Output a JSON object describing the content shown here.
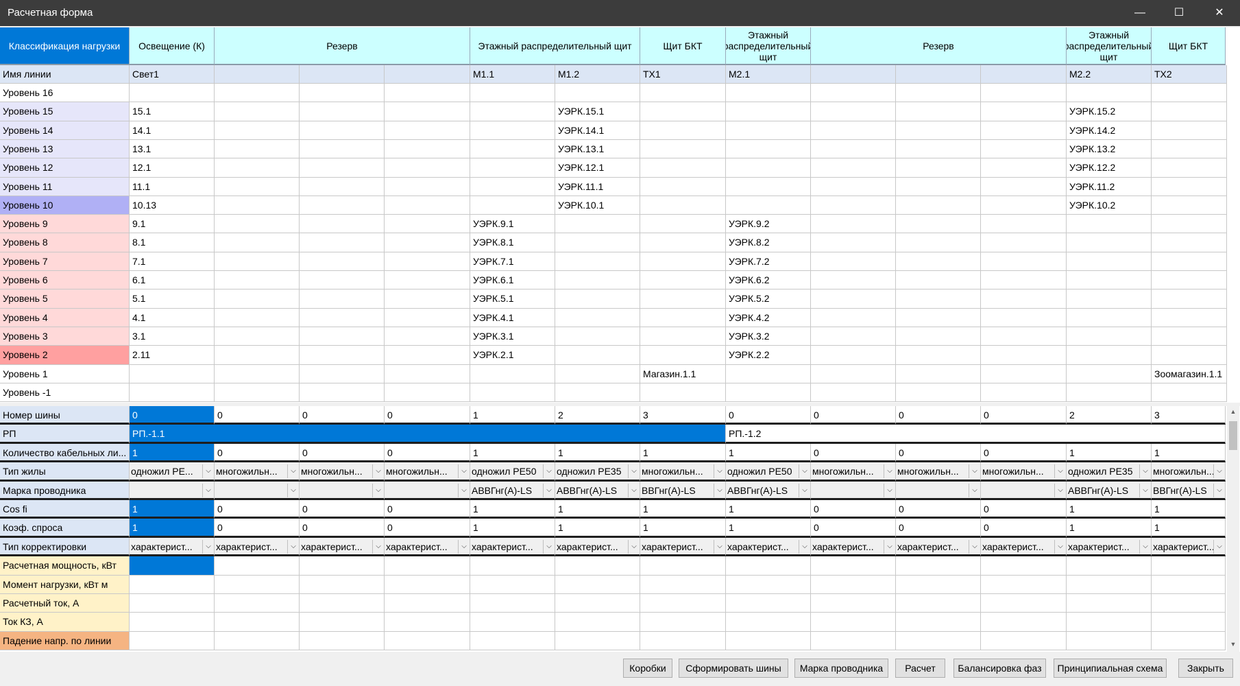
{
  "window": {
    "title": "Расчетная форма",
    "minimize_glyph": "—",
    "maximize_glyph": "☐",
    "close_glyph": "✕"
  },
  "groups": [
    {
      "label": "Классификация нагрузки"
    },
    {
      "label": "Освещение (К)"
    },
    {
      "label": "Резерв"
    },
    {
      "label": "Этажный распределительный щит"
    },
    {
      "label": "Щит БКТ"
    },
    {
      "label": "Этажный распределительный щит"
    },
    {
      "label": "Резерв"
    },
    {
      "label": "Этажный распределительный щит"
    },
    {
      "label": "Щит БКТ"
    }
  ],
  "line_names": {
    "label": "Имя линии",
    "values": [
      "Свет1",
      "",
      "",
      "",
      "М1.1",
      "М1.2",
      "ТХ1",
      "М2.1",
      "",
      "",
      "",
      "М2.2",
      "ТХ2"
    ]
  },
  "levels": [
    {
      "name": "Уровень 16",
      "color": "#ffffff",
      "cells": [
        "",
        "",
        "",
        "",
        "",
        "",
        "",
        "",
        "",
        "",
        "",
        "",
        ""
      ]
    },
    {
      "name": "Уровень 15",
      "color": "#e6e6fa",
      "cells": [
        "15.1",
        "",
        "",
        "",
        "",
        "УЭРК.15.1",
        "",
        "",
        "",
        "",
        "",
        "УЭРК.15.2",
        ""
      ]
    },
    {
      "name": "Уровень 14",
      "color": "#e6e6fa",
      "cells": [
        "14.1",
        "",
        "",
        "",
        "",
        "УЭРК.14.1",
        "",
        "",
        "",
        "",
        "",
        "УЭРК.14.2",
        ""
      ]
    },
    {
      "name": "Уровень 13",
      "color": "#e6e6fa",
      "cells": [
        "13.1",
        "",
        "",
        "",
        "",
        "УЭРК.13.1",
        "",
        "",
        "",
        "",
        "",
        "УЭРК.13.2",
        ""
      ]
    },
    {
      "name": "Уровень 12",
      "color": "#e6e6fa",
      "cells": [
        "12.1",
        "",
        "",
        "",
        "",
        "УЭРК.12.1",
        "",
        "",
        "",
        "",
        "",
        "УЭРК.12.2",
        ""
      ]
    },
    {
      "name": "Уровень 11",
      "color": "#e6e6fa",
      "cells": [
        "11.1",
        "",
        "",
        "",
        "",
        "УЭРК.11.1",
        "",
        "",
        "",
        "",
        "",
        "УЭРК.11.2",
        ""
      ]
    },
    {
      "name": "Уровень 10",
      "color": "#b0b0f5",
      "cells": [
        "10.13",
        "",
        "",
        "",
        "",
        "УЭРК.10.1",
        "",
        "",
        "",
        "",
        "",
        "УЭРК.10.2",
        ""
      ]
    },
    {
      "name": "Уровень 9",
      "color": "#ffd9d9",
      "cells": [
        "9.1",
        "",
        "",
        "",
        "УЭРК.9.1",
        "",
        "",
        "УЭРК.9.2",
        "",
        "",
        "",
        "",
        ""
      ]
    },
    {
      "name": "Уровень 8",
      "color": "#ffd9d9",
      "cells": [
        "8.1",
        "",
        "",
        "",
        "УЭРК.8.1",
        "",
        "",
        "УЭРК.8.2",
        "",
        "",
        "",
        "",
        ""
      ]
    },
    {
      "name": "Уровень 7",
      "color": "#ffd9d9",
      "cells": [
        "7.1",
        "",
        "",
        "",
        "УЭРК.7.1",
        "",
        "",
        "УЭРК.7.2",
        "",
        "",
        "",
        "",
        ""
      ]
    },
    {
      "name": "Уровень 6",
      "color": "#ffd9d9",
      "cells": [
        "6.1",
        "",
        "",
        "",
        "УЭРК.6.1",
        "",
        "",
        "УЭРК.6.2",
        "",
        "",
        "",
        "",
        ""
      ]
    },
    {
      "name": "Уровень 5",
      "color": "#ffd9d9",
      "cells": [
        "5.1",
        "",
        "",
        "",
        "УЭРК.5.1",
        "",
        "",
        "УЭРК.5.2",
        "",
        "",
        "",
        "",
        ""
      ]
    },
    {
      "name": "Уровень 4",
      "color": "#ffd9d9",
      "cells": [
        "4.1",
        "",
        "",
        "",
        "УЭРК.4.1",
        "",
        "",
        "УЭРК.4.2",
        "",
        "",
        "",
        "",
        ""
      ]
    },
    {
      "name": "Уровень 3",
      "color": "#ffd9d9",
      "cells": [
        "3.1",
        "",
        "",
        "",
        "УЭРК.3.1",
        "",
        "",
        "УЭРК.3.2",
        "",
        "",
        "",
        "",
        ""
      ]
    },
    {
      "name": "Уровень 2",
      "color": "#ffa0a0",
      "cells": [
        "2.11",
        "",
        "",
        "",
        "УЭРК.2.1",
        "",
        "",
        "УЭРК.2.2",
        "",
        "",
        "",
        "",
        ""
      ]
    },
    {
      "name": "Уровень 1",
      "color": "#ffffff",
      "cells": [
        "",
        "",
        "",
        "",
        "",
        "",
        "Магазин.1.1",
        "",
        "",
        "",
        "",
        "",
        "Зоомагазин.1.1"
      ]
    },
    {
      "name": "Уровень -1",
      "color": "#ffffff",
      "cells": [
        "",
        "",
        "",
        "",
        "",
        "",
        "",
        "",
        "",
        "",
        "",
        "",
        ""
      ]
    }
  ],
  "params": {
    "bus_number": {
      "label": "Номер шины",
      "values": [
        "0",
        "0",
        "0",
        "0",
        "1",
        "2",
        "3",
        "0",
        "0",
        "0",
        "0",
        "2",
        "3"
      ]
    },
    "rp": {
      "label": "РП",
      "values": [
        "РП.-1.1",
        "РП.-1.2"
      ]
    },
    "cable_count": {
      "label": "Количество кабельных ли...",
      "values": [
        "1",
        "0",
        "0",
        "0",
        "1",
        "1",
        "1",
        "1",
        "0",
        "0",
        "0",
        "1",
        "1"
      ]
    },
    "core_type": {
      "label": "Тип жилы",
      "values": [
        "одножил РЕ...",
        "многожильн...",
        "многожильн...",
        "многожильн...",
        "одножил РЕ50",
        "одножил РЕ35",
        "многожильн...",
        "одножил РЕ50",
        "многожильн...",
        "многожильн...",
        "многожильн...",
        "одножил РЕ35",
        "многожильн..."
      ]
    },
    "conductor_brand": {
      "label": "Марка проводника",
      "values": [
        "",
        "",
        "",
        "",
        "АВВГнг(А)-LS",
        "АВВГнг(А)-LS",
        "ВВГнг(А)-LS",
        "АВВГнг(А)-LS",
        "",
        "",
        "",
        "АВВГнг(А)-LS",
        "ВВГнг(А)-LS"
      ]
    },
    "cos_fi": {
      "label": "Cos fi",
      "values": [
        "1",
        "0",
        "0",
        "0",
        "1",
        "1",
        "1",
        "1",
        "0",
        "0",
        "0",
        "1",
        "1"
      ]
    },
    "demand_coef": {
      "label": "Коэф. спроса",
      "values": [
        "1",
        "0",
        "0",
        "0",
        "1",
        "1",
        "1",
        "1",
        "0",
        "0",
        "0",
        "1",
        "1"
      ]
    },
    "correction_type": {
      "label": "Тип корректировки",
      "values": [
        "характерист...",
        "характерист...",
        "характерист...",
        "характерист...",
        "характерист...",
        "характерист...",
        "характерист...",
        "характерист...",
        "характерист...",
        "характерист...",
        "характерист...",
        "характерист...",
        "характерист..."
      ]
    },
    "calc_power": {
      "label": "Расчетная мощность, кВт"
    },
    "load_moment": {
      "label": "Момент нагрузки, кВт м"
    },
    "calc_current": {
      "label": "Расчетный ток, А"
    },
    "sc_current": {
      "label": "Ток КЗ, А"
    },
    "voltage_drop": {
      "label": "Падение напр. по линии"
    }
  },
  "buttons": {
    "boxes": "Коробки",
    "form_buses": "Сформировать шины",
    "conductor_brand": "Марка проводника",
    "calc": "Расчет",
    "phase_balance": "Балансировка фаз",
    "schematic": "Принципиальная схема",
    "close": "Закрыть"
  },
  "colors": {
    "accent": "#0078d7",
    "header": "#ccffff",
    "label_blue": "#dce6f5",
    "label_yellow": "#fff2c8",
    "label_orange": "#f5b482"
  }
}
